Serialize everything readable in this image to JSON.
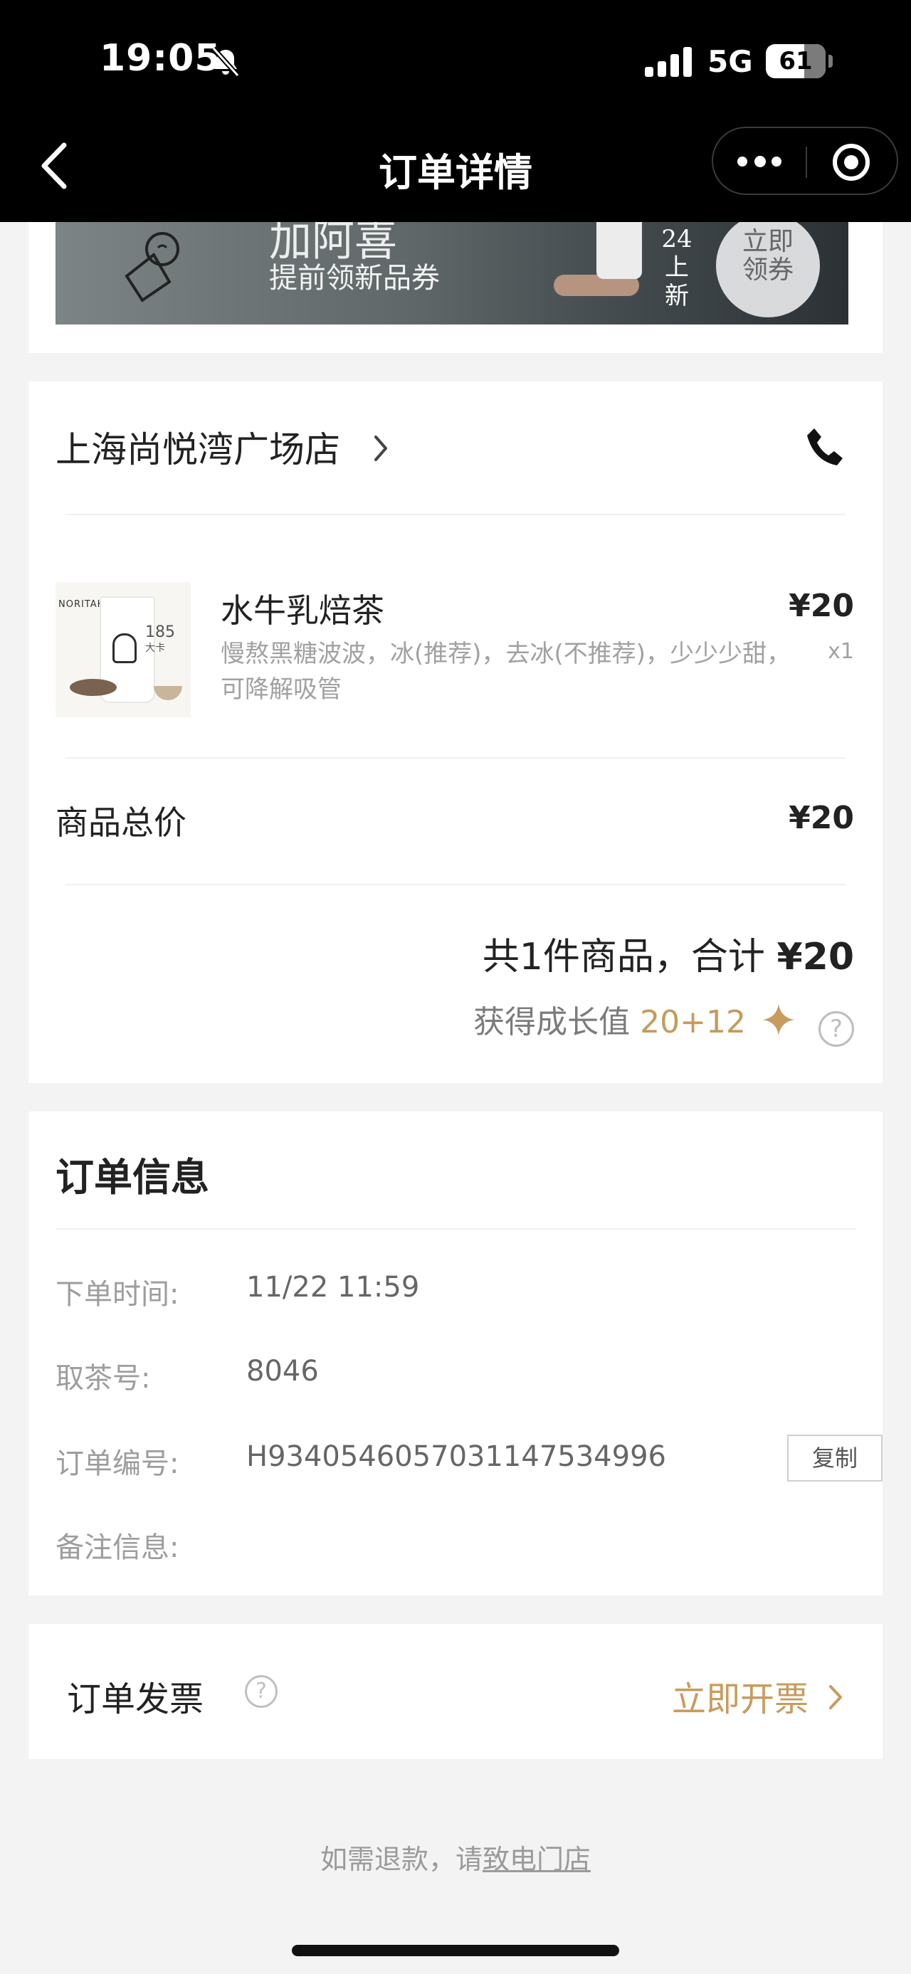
{
  "status_bar": {
    "time": "19:05",
    "network": "5G",
    "battery": "61"
  },
  "nav": {
    "title": "订单详情"
  },
  "banner": {
    "heading": "加阿喜",
    "subtitle": "提前领新品券",
    "side_text_1": "24",
    "side_text_2": "上",
    "side_text_3": "新",
    "button_line1": "立即",
    "button_line2": "领券"
  },
  "order": {
    "store_name": "上海尚悦湾广场店",
    "item": {
      "image_brand": "NORITAKE",
      "image_size": "185",
      "image_size_sub": "大卡",
      "name": "水牛乳焙茶",
      "spec": "慢熬黑糖波波，冰(推荐)，去冰(不推荐)，少少少甜，可降解吸管",
      "price": "¥20",
      "qty": "x1"
    },
    "subtotal_label": "商品总价",
    "subtotal_value": "¥20",
    "total_prefix": "共1件商品，合计 ",
    "total_amount": "¥20",
    "growth_label": "获得成长值 ",
    "growth_value": "20+12",
    "help_symbol": "?"
  },
  "info": {
    "title": "订单信息",
    "rows": [
      {
        "label": "下单时间:",
        "value": "11/22 11:59"
      },
      {
        "label": "取茶号:",
        "value": "8046"
      },
      {
        "label": "订单编号:",
        "value": "H9340546057031147534996"
      },
      {
        "label": "备注信息:",
        "value": ""
      }
    ],
    "copy_label": "复制"
  },
  "invoice": {
    "label": "订单发票",
    "help_symbol": "?",
    "action": "立即开票"
  },
  "footer": {
    "refund_prefix": "如需退款，请",
    "refund_link": "致电门店"
  },
  "colors": {
    "accent_gold": "#c89b5e",
    "nav_bg": "#000000",
    "page_bg": "#f3f3f3"
  }
}
